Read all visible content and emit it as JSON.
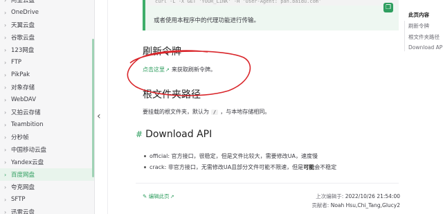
{
  "sidebar": {
    "items": [
      {
        "label": "阿里云盘",
        "active": false
      },
      {
        "label": "OneDrive",
        "active": false
      },
      {
        "label": "天翼云盘",
        "active": false
      },
      {
        "label": "谷歌云盘",
        "active": false
      },
      {
        "label": "123网盘",
        "active": false
      },
      {
        "label": "FTP",
        "active": false
      },
      {
        "label": "PikPak",
        "active": false
      },
      {
        "label": "对象存储",
        "active": false
      },
      {
        "label": "WebDAV",
        "active": false
      },
      {
        "label": "又拍云存储",
        "active": false
      },
      {
        "label": "Teambition",
        "active": false
      },
      {
        "label": "分秒帧",
        "active": false
      },
      {
        "label": "中国移动云盘",
        "active": false
      },
      {
        "label": "Yandex云盘",
        "active": false
      },
      {
        "label": "百度网盘",
        "active": true
      },
      {
        "label": "夸克网盘",
        "active": false
      },
      {
        "label": "SFTP",
        "active": false
      },
      {
        "label": "迅雷云盘",
        "active": false
      }
    ],
    "collapse_icon": "chevron-left-icon"
  },
  "main": {
    "code_line": "curl -L -X GET 'YOUR_LINK' -H 'User-Agent: pan.baidu.com'",
    "tip_text": "或者使用本程序中的代理功能进行传输。",
    "refresh_heading": "刷新令牌",
    "refresh_link": "点击这里",
    "refresh_text": "来获取刷新令牌。",
    "root_heading": "根文件夹路径",
    "root_text_before": "要挂载的根文件夹，默认为",
    "root_code": "/",
    "root_text_after": "，与本地存储相同。",
    "api_hash": "#",
    "api_heading": "Download API",
    "bullets": [
      {
        "prefix": "official: 官方接口，很稳定，但是文件比较大，需要修改UA，速度慢",
        "bold": "",
        "suffix": ""
      },
      {
        "prefix": "crack: 非官方接口，无需修改UA且部分文件可能不限速，但是",
        "bold": "可能",
        "suffix": "会不稳定"
      }
    ],
    "edit_link": "编辑此页",
    "updated_label": "上次编辑于:",
    "updated_value": "2022/10/26 21:54:00",
    "contrib_label": "贡献者:",
    "contrib_value": "Noah Hsu,Chi_Tang,Glucy2"
  },
  "toc": {
    "title": "此页内容",
    "items": [
      "刷新令牌",
      "根文件夹路径",
      "Download API"
    ]
  },
  "colors": {
    "accent": "#2f9e5f",
    "annotation": "#d9262b"
  }
}
